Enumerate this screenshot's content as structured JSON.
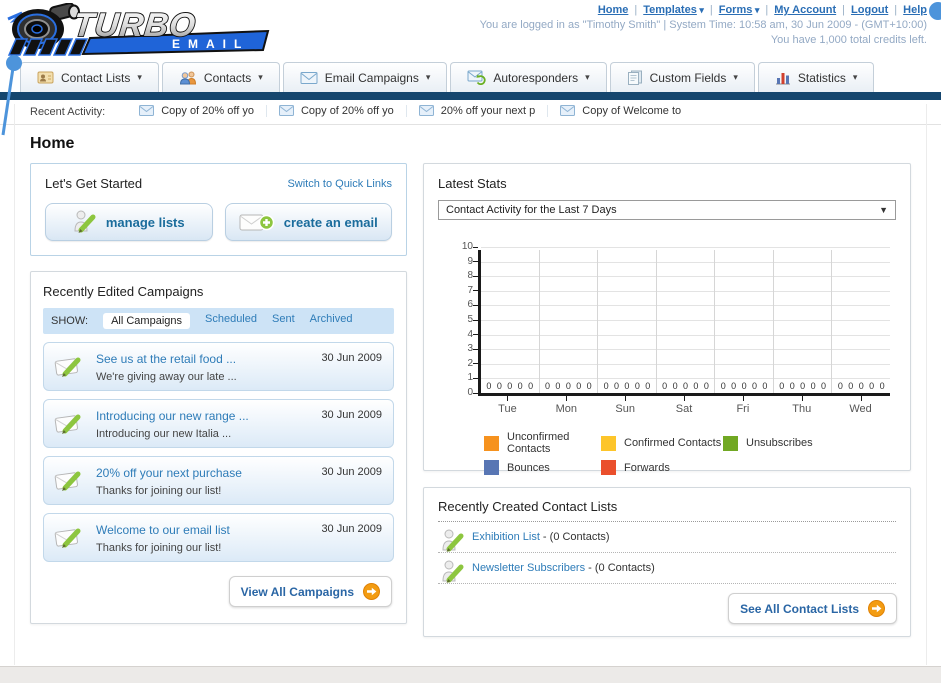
{
  "header": {
    "nav_links": [
      {
        "label": "Home",
        "dropdown": false
      },
      {
        "label": "Templates",
        "dropdown": true
      },
      {
        "label": "Forms",
        "dropdown": true
      },
      {
        "label": "My Account",
        "dropdown": false
      },
      {
        "label": "Logout",
        "dropdown": false
      },
      {
        "label": "Help",
        "dropdown": false
      }
    ],
    "status_line": "You are logged in as \"Timothy Smith\" | System Time: 10:58 am, 30 Jun 2009 - (GMT+10:00)",
    "credits_line": "You have 1,000 total credits left.",
    "logo_line1": "TURBO",
    "logo_line2": "EMAIL"
  },
  "tabs": [
    {
      "label": "Contact Lists",
      "icon": "contact-lists-icon"
    },
    {
      "label": "Contacts",
      "icon": "contacts-icon"
    },
    {
      "label": "Email Campaigns",
      "icon": "email-campaigns-icon"
    },
    {
      "label": "Autoresponders",
      "icon": "autoresponders-icon"
    },
    {
      "label": "Custom Fields",
      "icon": "custom-fields-icon"
    },
    {
      "label": "Statistics",
      "icon": "statistics-icon"
    }
  ],
  "recent_activity": {
    "label": "Recent Activity:",
    "items": [
      "Copy of 20% off yo",
      "Copy of 20% off yo",
      "20% off your next p",
      "Copy of Welcome to"
    ]
  },
  "page_title": "Home",
  "get_started": {
    "title": "Let's Get Started",
    "switch_link": "Switch to Quick Links",
    "buttons": [
      {
        "label": "manage lists",
        "icon": "person-pencil-icon"
      },
      {
        "label": "create an email",
        "icon": "envelope-plus-icon"
      }
    ]
  },
  "campaigns": {
    "title": "Recently Edited Campaigns",
    "show_label": "SHOW:",
    "filters": [
      {
        "label": "All Campaigns",
        "active": true
      },
      {
        "label": "Scheduled",
        "active": false
      },
      {
        "label": "Sent",
        "active": false
      },
      {
        "label": "Archived",
        "active": false
      }
    ],
    "items": [
      {
        "title": "See us at the retail food ...",
        "subtitle": "We're giving away our late ...",
        "date": "30 Jun 2009"
      },
      {
        "title": "Introducing our new range ...",
        "subtitle": "Introducing our new Italia ...",
        "date": "30 Jun 2009"
      },
      {
        "title": "20% off your next purchase",
        "subtitle": "Thanks for joining our list!",
        "date": "30 Jun 2009"
      },
      {
        "title": "Welcome to our email list",
        "subtitle": "Thanks for joining our list!",
        "date": "30 Jun 2009"
      }
    ],
    "view_all_label": "View All Campaigns"
  },
  "stats": {
    "title": "Latest Stats",
    "dropdown_value": "Contact Activity for the Last 7 Days"
  },
  "chart_data": {
    "type": "bar",
    "title": "Contact Activity for the Last 7 Days",
    "categories": [
      "Tue",
      "Mon",
      "Sun",
      "Sat",
      "Fri",
      "Thu",
      "Wed"
    ],
    "series": [
      {
        "name": "Unconfirmed Contacts",
        "color": "#f6921e",
        "values": [
          0,
          0,
          0,
          0,
          0,
          0,
          0
        ]
      },
      {
        "name": "Confirmed Contacts",
        "color": "#fdc52a",
        "values": [
          0,
          0,
          0,
          0,
          0,
          0,
          0
        ]
      },
      {
        "name": "Unsubscribes",
        "color": "#71a823",
        "values": [
          0,
          0,
          0,
          0,
          0,
          0,
          0
        ]
      },
      {
        "name": "Bounces",
        "color": "#5876b4",
        "values": [
          0,
          0,
          0,
          0,
          0,
          0,
          0
        ]
      },
      {
        "name": "Forwards",
        "color": "#ea4f2c",
        "values": [
          0,
          0,
          0,
          0,
          0,
          0,
          0
        ]
      }
    ],
    "ylim": [
      0,
      10
    ],
    "yticks": [
      0,
      1,
      2,
      3,
      4,
      5,
      6,
      7,
      8,
      9,
      10
    ],
    "grid": true,
    "legend_position": "bottom",
    "data_labels": "0"
  },
  "contact_lists": {
    "title": "Recently Created Contact Lists",
    "items": [
      {
        "name": "Exhibition List",
        "suffix": " - (0 Contacts)"
      },
      {
        "name": "Newsletter Subscribers",
        "suffix": " - (0 Contacts)"
      }
    ],
    "see_all_label": "See All Contact Lists"
  },
  "colors": {
    "brand_navy": "#15466e",
    "brand_blue": "#1f64d8",
    "link_blue": "#2e7cb8",
    "accent_orange": "#f39c12",
    "show_bar_blue": "#cde3f6"
  },
  "glyphs": {
    "caret": "▾",
    "select_arrow": "▼",
    "separator": "|"
  }
}
